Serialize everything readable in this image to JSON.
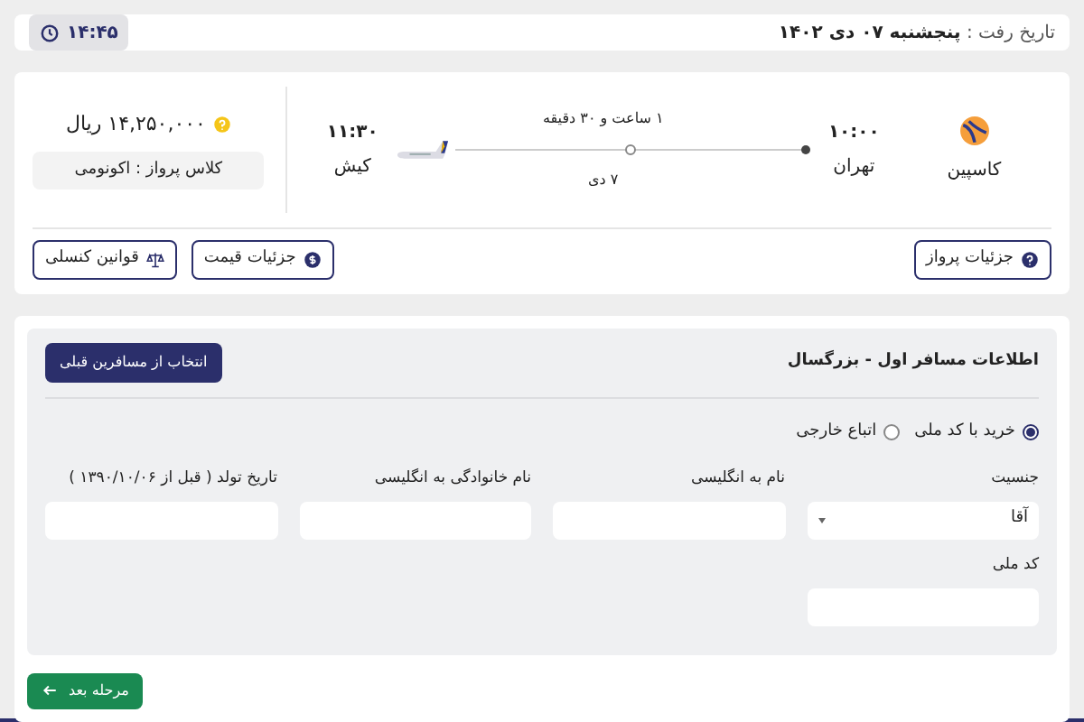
{
  "header": {
    "date_label": "تاریخ رفت :",
    "date": "پنجشنبه ۰۷ دی ۱۴۰۲",
    "time": "۱۴:۴۵"
  },
  "flight": {
    "airline": "کاسپین",
    "departure": {
      "time": "۱۰:۰۰",
      "city": "تهران"
    },
    "arrival": {
      "time": "۱۱:۳۰",
      "city": "کیش"
    },
    "duration": "۱ ساعت و ۳۰ دقیقه",
    "date": "۷ دی",
    "price": "۱۴,۲۵۰,۰۰۰ ریال",
    "fare_class": "کلاس پرواز : اکونومی",
    "buttons": [
      {
        "kind": "details",
        "label": "جزئیات پرواز"
      },
      {
        "kind": "price",
        "label": "جزئیات قیمت"
      },
      {
        "kind": "rules",
        "label": "قوانین کنسلی"
      }
    ]
  },
  "passenger_form": {
    "title": "اطلاعات مسافر اول - بزرگسال",
    "select_previous_button": "انتخاب از مسافرین قبلی",
    "id_options": [
      {
        "label": "خرید با کد ملی",
        "selected": true
      },
      {
        "label": "اتباع خارجی",
        "selected": false
      }
    ],
    "fields": [
      {
        "kind": "select",
        "label": "جنسیت",
        "value": "آقا"
      },
      {
        "kind": "text",
        "label": "نام به انگلیسی"
      },
      {
        "kind": "text",
        "label": "نام خانوادگی به انگلیسی"
      },
      {
        "kind": "text",
        "label": "تاریخ تولد ( قبل از ۱۳۹۰/۱۰/۰۶ )"
      },
      {
        "kind": "text",
        "label": "کد ملی"
      }
    ],
    "next_button": "مرحله بعد"
  }
}
